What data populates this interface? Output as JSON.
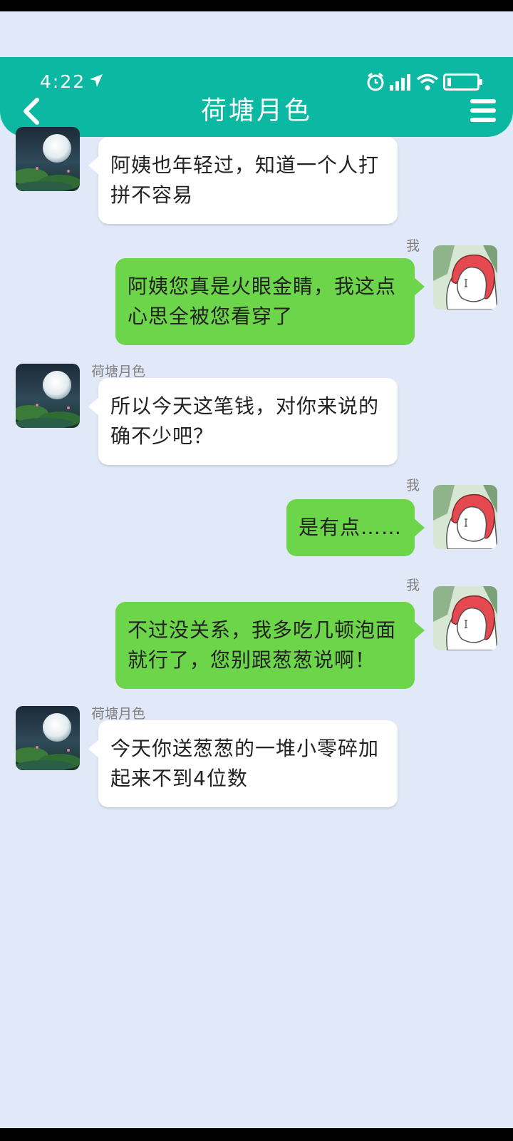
{
  "status_bar": {
    "time": "4:22"
  },
  "header": {
    "title": "荷塘月色"
  },
  "icons": {
    "back": "chevron-left-icon",
    "menu": "hamburger-menu-icon",
    "location": "location-arrow-icon",
    "alarm": "alarm-icon",
    "signal": "signal-icon",
    "wifi": "wifi-icon",
    "battery": "battery-icon"
  },
  "colors": {
    "header": "#0bb8a2",
    "background": "#e1e8f8",
    "my_bubble": "#6dd549",
    "their_bubble": "#ffffff"
  },
  "messages": [
    {
      "side": "left",
      "sender": "",
      "text": "阿姨也年轻过，知道一个人打拼不容易"
    },
    {
      "side": "right",
      "sender": "我",
      "text": "阿姨您真是火眼金睛，我这点心思全被您看穿了"
    },
    {
      "side": "left",
      "sender": "荷塘月色",
      "text": "所以今天这笔钱，对你来说的确不少吧？"
    },
    {
      "side": "right",
      "sender": "我",
      "text": "是有点……"
    },
    {
      "side": "right",
      "sender": "我",
      "text": "不过没关系，我多吃几顿泡面就行了，您别跟葱葱说啊！"
    },
    {
      "side": "left",
      "sender": "荷塘月色",
      "text": "今天你送葱葱的一堆小零碎加起来不到4位数"
    }
  ]
}
